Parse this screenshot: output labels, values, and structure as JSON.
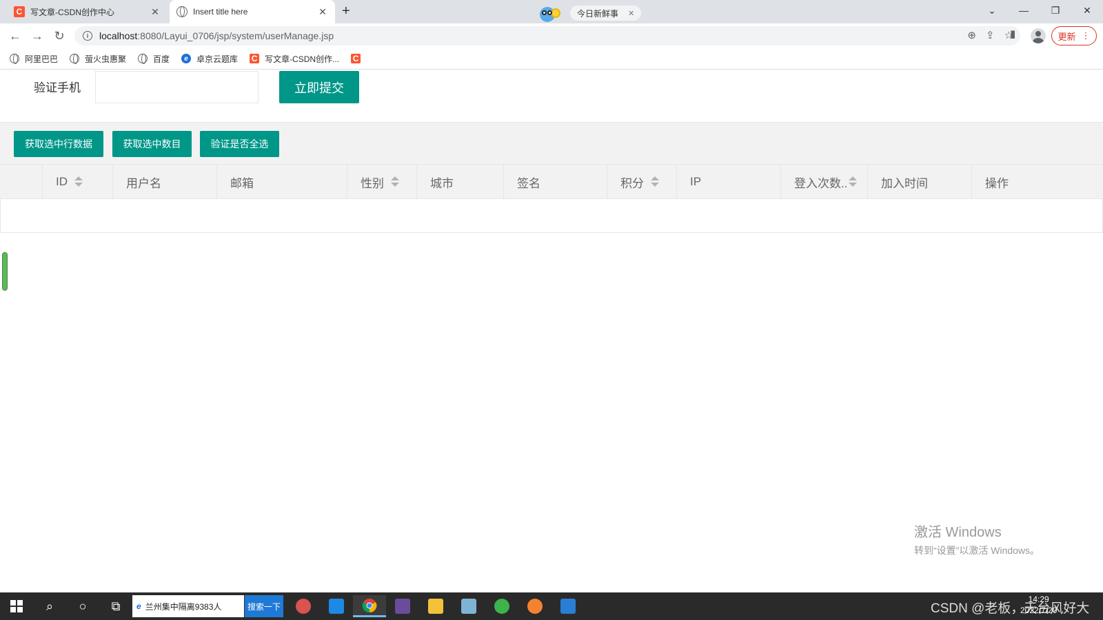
{
  "browser": {
    "tabs": [
      {
        "title": "写文章-CSDN创作中心",
        "favicon": "csdn-icon"
      },
      {
        "title": "Insert title here",
        "favicon": "globe-icon"
      }
    ],
    "ad_pill": "今日新鲜事",
    "url_host": "localhost",
    "url_path": ":8080/Layui_0706/jsp/system/userManage.jsp",
    "update_label": "更新",
    "csdn_glyph": "C",
    "bookmarks": [
      {
        "label": "阿里巴巴",
        "icon": "globe-icon"
      },
      {
        "label": "萤火虫惠聚",
        "icon": "globe-icon"
      },
      {
        "label": "百度",
        "icon": "globe-icon"
      },
      {
        "label": "卓京云题库",
        "icon": "ie-icon"
      },
      {
        "label": "写文章-CSDN创作...",
        "icon": "csdn-icon"
      }
    ]
  },
  "form": {
    "phone_label": "验证手机",
    "phone_value": "",
    "submit_label": "立即提交"
  },
  "table": {
    "toolbar_buttons": [
      "获取选中行数据",
      "获取选中数目",
      "验证是否全选"
    ],
    "columns": [
      "ID",
      "用户名",
      "邮箱",
      "性别",
      "城市",
      "签名",
      "积分",
      "IP",
      "登入次数..",
      "加入时间",
      "操作"
    ],
    "rows": []
  },
  "watermark": {
    "line1": "激活 Windows",
    "line2": "转到“设置”以激活 Windows。"
  },
  "taskbar": {
    "search_text": "兰州集中隔离9383人",
    "search_button": "搜索一下",
    "tray_text": "CSDN @老板，天台风好大",
    "time": "14:29",
    "date": "2022/7/20"
  },
  "colors": {
    "accent": "#009688",
    "taskbar": "#2b2a2a",
    "csdn": "#fc5531"
  }
}
